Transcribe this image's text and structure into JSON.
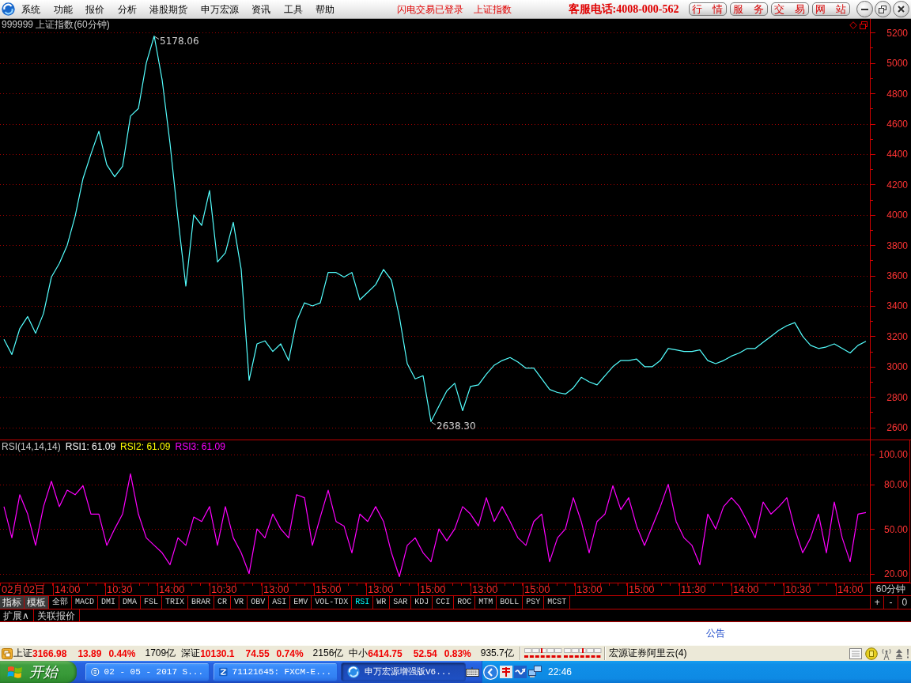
{
  "menu_bar": {
    "items": [
      "系统",
      "功能",
      "报价",
      "分析",
      "港股期货",
      "申万宏源",
      "资讯",
      "工具",
      "帮助"
    ],
    "login_status": "闪电交易已登录",
    "current_index": "上证指数",
    "hotline": "客服电话:4008-000-562",
    "buttons": [
      "行 情",
      "服 务",
      "交 易",
      "网 站"
    ]
  },
  "price_chart": {
    "chart_data": {
      "type": "line",
      "title": "999999 上证指数(60分钟)",
      "ylim": [
        2520,
        5290
      ],
      "yticks": [
        2600,
        2800,
        3000,
        3200,
        3400,
        3600,
        3800,
        4000,
        4200,
        4400,
        4600,
        4800,
        5000,
        5200
      ],
      "grid": true,
      "series": [
        {
          "color": "#54ffff",
          "values": [
            3180,
            3080,
            3250,
            3330,
            3220,
            3350,
            3590,
            3680,
            3800,
            3990,
            4240,
            4400,
            4550,
            4330,
            4250,
            4320,
            4650,
            4700,
            5000,
            5178,
            4890,
            4470,
            3980,
            3530,
            4000,
            3930,
            4160,
            3690,
            3750,
            3950,
            3640,
            2910,
            3150,
            3170,
            3100,
            3150,
            3040,
            3300,
            3420,
            3400,
            3420,
            3620,
            3620,
            3590,
            3620,
            3440,
            3490,
            3540,
            3640,
            3570,
            3330,
            3020,
            2920,
            2940,
            2638,
            2740,
            2840,
            2890,
            2710,
            2870,
            2880,
            2950,
            3010,
            3040,
            3060,
            3030,
            2990,
            2990,
            2920,
            2850,
            2830,
            2820,
            2860,
            2930,
            2900,
            2880,
            2940,
            3000,
            3040,
            3040,
            3050,
            3000,
            3000,
            3040,
            3120,
            3110,
            3100,
            3100,
            3110,
            3040,
            3020,
            3040,
            3070,
            3090,
            3120,
            3120,
            3160,
            3200,
            3240,
            3270,
            3290,
            3200,
            3140,
            3120,
            3130,
            3150,
            3120,
            3090,
            3140,
            3167
          ]
        }
      ],
      "annotations": [
        "5178.06",
        "2638.30"
      ]
    }
  },
  "rsi_chart": {
    "label": "RSI(14,14,14)",
    "readings": [
      {
        "text": "RSI1: 61.09",
        "color": "#ffffff"
      },
      {
        "text": "RSI2: 61.09",
        "color": "#ffff00"
      },
      {
        "text": "RSI3: 61.09",
        "color": "#ff00ff"
      }
    ],
    "chart_data": {
      "type": "line",
      "ylim": [
        14,
        101
      ],
      "yticks": [
        {
          "value": 20,
          "label": "20.00"
        },
        {
          "value": 50,
          "label": "50.00"
        },
        {
          "value": 80,
          "label": "80.00"
        },
        {
          "value": 100,
          "label": "100.00"
        }
      ],
      "grid": true,
      "series": [
        {
          "color": "#ff00ff",
          "values": [
            65,
            44,
            73,
            60,
            39,
            65,
            82,
            65,
            76,
            73,
            79,
            60,
            60,
            39,
            50,
            60,
            87,
            60,
            44,
            39,
            34,
            26,
            44,
            39,
            58,
            55,
            65,
            39,
            65,
            44,
            34,
            20,
            50,
            44,
            60,
            50,
            44,
            73,
            71,
            39,
            58,
            76,
            55,
            52,
            34,
            60,
            55,
            65,
            55,
            34,
            18,
            39,
            44,
            34,
            28,
            50,
            42,
            50,
            65,
            60,
            52,
            71,
            55,
            65,
            55,
            44,
            39,
            55,
            60,
            28,
            44,
            50,
            71,
            55,
            34,
            55,
            60,
            79,
            63,
            71,
            52,
            39,
            52,
            65,
            80,
            55,
            44,
            39,
            26,
            60,
            50,
            65,
            71,
            65,
            55,
            44,
            68,
            60,
            65,
            71,
            50,
            34,
            44,
            60,
            34,
            68,
            44,
            28,
            60,
            61
          ]
        }
      ]
    }
  },
  "time_axis": {
    "labels": [
      "02月02日",
      "14:00",
      "10:30",
      "14:00",
      "10:30",
      "13:00",
      "15:00",
      "13:00",
      "15:00",
      "13:00",
      "15:00",
      "13:00",
      "15:00",
      "11:30",
      "14:00",
      "10:30",
      "14:00"
    ],
    "period": "60分钟"
  },
  "indicator_bar": {
    "modes": [
      "指标",
      "模板"
    ],
    "tabs": [
      {
        "label": "全部",
        "selected": false
      },
      {
        "label": "MACD",
        "selected": false
      },
      {
        "label": "DMI",
        "selected": false
      },
      {
        "label": "DMA",
        "selected": false
      },
      {
        "label": "FSL",
        "selected": false
      },
      {
        "label": "TRIX",
        "selected": false
      },
      {
        "label": "BRAR",
        "selected": false
      },
      {
        "label": "CR",
        "selected": false
      },
      {
        "label": "VR",
        "selected": false
      },
      {
        "label": "OBV",
        "selected": false
      },
      {
        "label": "ASI",
        "selected": false
      },
      {
        "label": "EMV",
        "selected": false
      },
      {
        "label": "VOL-TDX",
        "selected": false
      },
      {
        "label": "RSI",
        "selected": true
      },
      {
        "label": "WR",
        "selected": false
      },
      {
        "label": "SAR",
        "selected": false
      },
      {
        "label": "KDJ",
        "selected": false
      },
      {
        "label": "CCI",
        "selected": false
      },
      {
        "label": "ROC",
        "selected": false
      },
      {
        "label": "MTM",
        "selected": false
      },
      {
        "label": "BOLL",
        "selected": false
      },
      {
        "label": "PSY",
        "selected": false
      },
      {
        "label": "MCST",
        "selected": false
      }
    ],
    "zoom_buttons": [
      "+",
      "-",
      "0"
    ]
  },
  "extension_bar": {
    "items": [
      "扩展∧",
      "关联报价"
    ]
  },
  "notice_bar": {
    "title": "公告"
  },
  "status_bar": {
    "indices": [
      {
        "name": "上证",
        "value": "3166.98",
        "change": "13.89",
        "percent": "0.44%",
        "turnover": "1709亿",
        "rising": true
      },
      {
        "name": "深证",
        "value": "10130.1",
        "change": "74.55",
        "percent": "0.74%",
        "turnover": "2156亿",
        "rising": true
      },
      {
        "name": "中小",
        "value": "6414.75",
        "change": "52.54",
        "percent": "0.83%",
        "turnover": "935.7亿",
        "rising": true
      }
    ],
    "server": "宏源证券阿里云(4)"
  },
  "taskbar": {
    "start": "开始",
    "tasks": [
      {
        "label": "02 - 05 - 2017 S...",
        "kind": "browser",
        "selected": false
      },
      {
        "label": "71121645: FXCM-E...",
        "kind": "terminal",
        "selected": false
      },
      {
        "label": "申万宏源增强版V6...",
        "kind": "client",
        "selected": true
      }
    ],
    "clock": "22:46"
  }
}
